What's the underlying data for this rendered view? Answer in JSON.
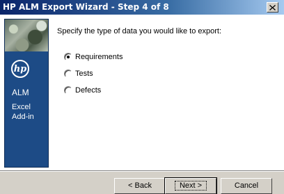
{
  "window": {
    "title": "HP ALM Export Wizard - Step 4 of 8",
    "close_icon": "close-icon"
  },
  "sidebar": {
    "logo_text": "hp",
    "product": "ALM",
    "subtitle_line1": "Excel",
    "subtitle_line2": "Add-in"
  },
  "main": {
    "prompt": "Specify the type of data you would like to export:",
    "options": [
      {
        "label": "Requirements",
        "checked": true
      },
      {
        "label": "Tests",
        "checked": false
      },
      {
        "label": "Defects",
        "checked": false
      }
    ]
  },
  "footer": {
    "back_label": "< Back",
    "next_label": "Next >",
    "cancel_label": "Cancel"
  }
}
